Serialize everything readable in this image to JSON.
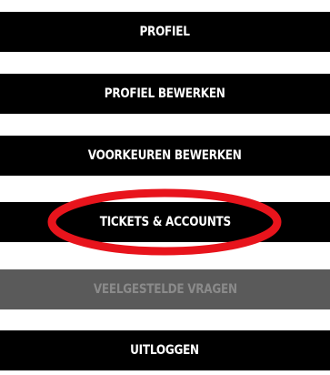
{
  "menu": {
    "items": [
      {
        "label": "PROFIEL",
        "enabled": true
      },
      {
        "label": "PROFIEL BEWERKEN",
        "enabled": true
      },
      {
        "label": "VOORKEUREN BEWERKEN",
        "enabled": true
      },
      {
        "label": "TICKETS & ACCOUNTS",
        "enabled": true,
        "highlighted": true
      },
      {
        "label": "VEELGESTELDE VRAGEN",
        "enabled": false
      },
      {
        "label": "UITLOGGEN",
        "enabled": true
      }
    ]
  },
  "colors": {
    "button_bg": "#000000",
    "button_text": "#ffffff",
    "disabled_bg": "#5a5a5a",
    "disabled_text": "#8a8a8a",
    "highlight_ring": "#e8141c"
  }
}
